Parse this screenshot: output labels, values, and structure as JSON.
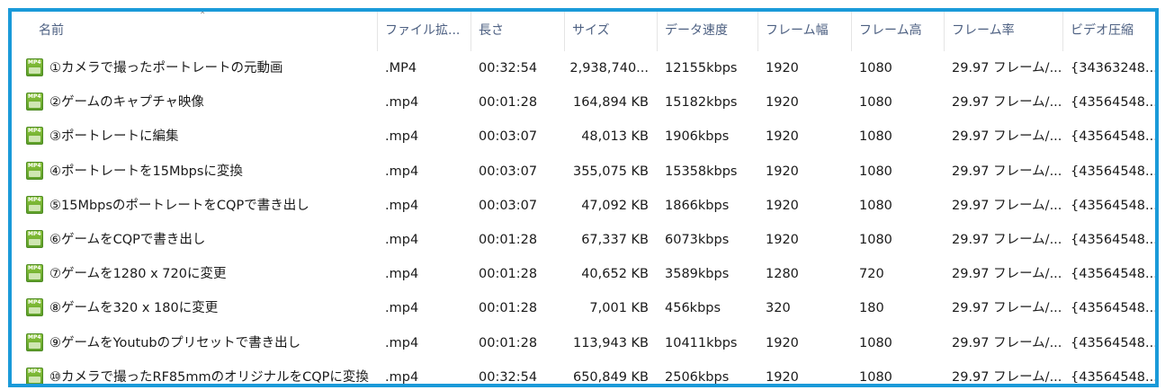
{
  "columns": {
    "name": "名前",
    "ext": "ファイル拡...",
    "length": "長さ",
    "size": "サイズ",
    "datarate": "データ速度",
    "width": "フレーム幅",
    "height": "フレーム高",
    "framerate": "フレーム率",
    "compression": "ビデオ圧縮"
  },
  "sort": {
    "column": "name",
    "direction": "ascending"
  },
  "icon": {
    "name": "mp4-file-icon",
    "label": "MP4",
    "color": "#7ab534"
  },
  "colors": {
    "border": "#1a9ad9",
    "header_text": "#4d6082",
    "text": "#1a1a1a"
  },
  "files": [
    {
      "name": "①カメラで撮ったポートレートの元動画",
      "ext": ".MP4",
      "length": "00:32:54",
      "size": "2,938,740...",
      "datarate": "12155kbps",
      "width": "1920",
      "height": "1080",
      "framerate": "29.97 フレーム/...",
      "compression": "{34363248..."
    },
    {
      "name": "②ゲームのキャプチャ映像",
      "ext": ".mp4",
      "length": "00:01:28",
      "size": "164,894 KB",
      "datarate": "15182kbps",
      "width": "1920",
      "height": "1080",
      "framerate": "29.97 フレーム/...",
      "compression": "{43564548..."
    },
    {
      "name": "③ポートレートに編集",
      "ext": ".mp4",
      "length": "00:03:07",
      "size": "48,013 KB",
      "datarate": "1906kbps",
      "width": "1920",
      "height": "1080",
      "framerate": "29.97 フレーム/...",
      "compression": "{43564548..."
    },
    {
      "name": "④ポートレートを15Mbpsに変換",
      "ext": ".mp4",
      "length": "00:03:07",
      "size": "355,075 KB",
      "datarate": "15358kbps",
      "width": "1920",
      "height": "1080",
      "framerate": "29.97 フレーム/...",
      "compression": "{43564548..."
    },
    {
      "name": "⑤15MbpsのポートレートをCQPで書き出し",
      "ext": ".mp4",
      "length": "00:03:07",
      "size": "47,092 KB",
      "datarate": "1866kbps",
      "width": "1920",
      "height": "1080",
      "framerate": "29.97 フレーム/...",
      "compression": "{43564548..."
    },
    {
      "name": "⑥ゲームをCQPで書き出し",
      "ext": ".mp4",
      "length": "00:01:28",
      "size": "67,337 KB",
      "datarate": "6073kbps",
      "width": "1920",
      "height": "1080",
      "framerate": "29.97 フレーム/...",
      "compression": "{43564548..."
    },
    {
      "name": "⑦ゲームを1280 x 720に変更",
      "ext": ".mp4",
      "length": "00:01:28",
      "size": "40,652 KB",
      "datarate": "3589kbps",
      "width": "1280",
      "height": "720",
      "framerate": "29.97 フレーム/...",
      "compression": "{43564548..."
    },
    {
      "name": "⑧ゲームを320 x 180に変更",
      "ext": ".mp4",
      "length": "00:01:28",
      "size": "7,001 KB",
      "datarate": "456kbps",
      "width": "320",
      "height": "180",
      "framerate": "29.97 フレーム/...",
      "compression": "{43564548..."
    },
    {
      "name": "⑨ゲームをYoutubのプリセットで書き出し",
      "ext": ".mp4",
      "length": "00:01:28",
      "size": "113,943 KB",
      "datarate": "10411kbps",
      "width": "1920",
      "height": "1080",
      "framerate": "29.97 フレーム/...",
      "compression": "{43564548..."
    },
    {
      "name": "⑩カメラで撮ったRF85mmのオリジナルをCQPに変換",
      "ext": ".mp4",
      "length": "00:32:54",
      "size": "650,849 KB",
      "datarate": "2506kbps",
      "width": "1920",
      "height": "1080",
      "framerate": "29.97 フレーム/...",
      "compression": "{43564548..."
    }
  ]
}
